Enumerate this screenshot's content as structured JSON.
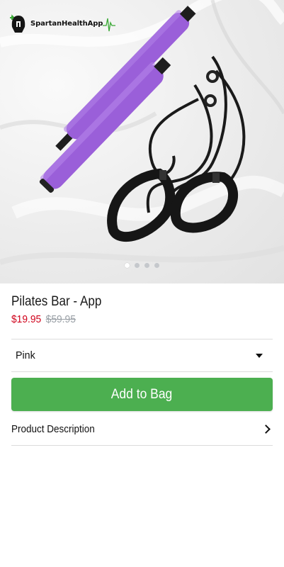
{
  "brand": {
    "logo_text": "SpartanHealthApp",
    "logo_icon": "spartan-helmet-icon",
    "accent": "#3aa935"
  },
  "gallery": {
    "image": "pilates-bar-product-photo",
    "slide_count": 4,
    "active_slide": 1
  },
  "product": {
    "title": "Pilates Bar - App",
    "price_sale": "$19.95",
    "price_original": "$59.95"
  },
  "variant": {
    "selected": "Pink",
    "icon": "caret-down-icon"
  },
  "actions": {
    "add_to_bag_label": "Add to Bag",
    "button_color": "#4caf50"
  },
  "details": {
    "description_label": "Product Description",
    "icon": "chevron-right-icon"
  },
  "colors": {
    "sale_price": "#d0021b",
    "original_price": "#9aa0a6",
    "bar_purple": "#9a5fd9"
  }
}
